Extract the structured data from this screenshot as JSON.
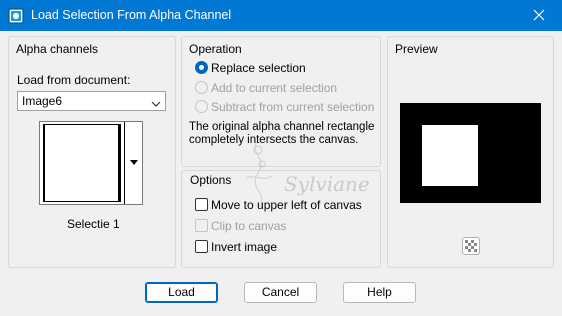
{
  "window": {
    "title": "Load Selection From Alpha Channel",
    "icons": {
      "app": "alpha-channel-app-icon",
      "close": "close-icon"
    }
  },
  "alpha_channels": {
    "group_title": "Alpha channels",
    "load_from_label": "Load from document:",
    "document_select": {
      "value": "Image6",
      "icon": "chevron-down-icon"
    },
    "channel_name": "Selectie 1"
  },
  "operation": {
    "group_title": "Operation",
    "options": [
      {
        "label": "Replace selection",
        "checked": true,
        "enabled": true
      },
      {
        "label": "Add to current selection",
        "checked": false,
        "enabled": false
      },
      {
        "label": "Subtract from current selection",
        "checked": false,
        "enabled": false
      }
    ],
    "description": "The original alpha channel rectangle completely intersects the canvas."
  },
  "options": {
    "group_title": "Options",
    "checkboxes": [
      {
        "label": "Move to upper left of canvas",
        "checked": false,
        "enabled": true
      },
      {
        "label": "Clip to canvas",
        "checked": false,
        "enabled": false
      },
      {
        "label": "Invert image",
        "checked": false,
        "enabled": true
      }
    ]
  },
  "preview": {
    "group_title": "Preview",
    "icons": {
      "background_toggle": "checkerboard-icon"
    }
  },
  "watermark": {
    "text": "Sylviane"
  },
  "buttons": {
    "load": "Load",
    "cancel": "Cancel",
    "help": "Help"
  },
  "colors": {
    "titlebar": "#0078d4",
    "accent": "#0067c0",
    "dialog_bg": "#f0f0f0"
  }
}
